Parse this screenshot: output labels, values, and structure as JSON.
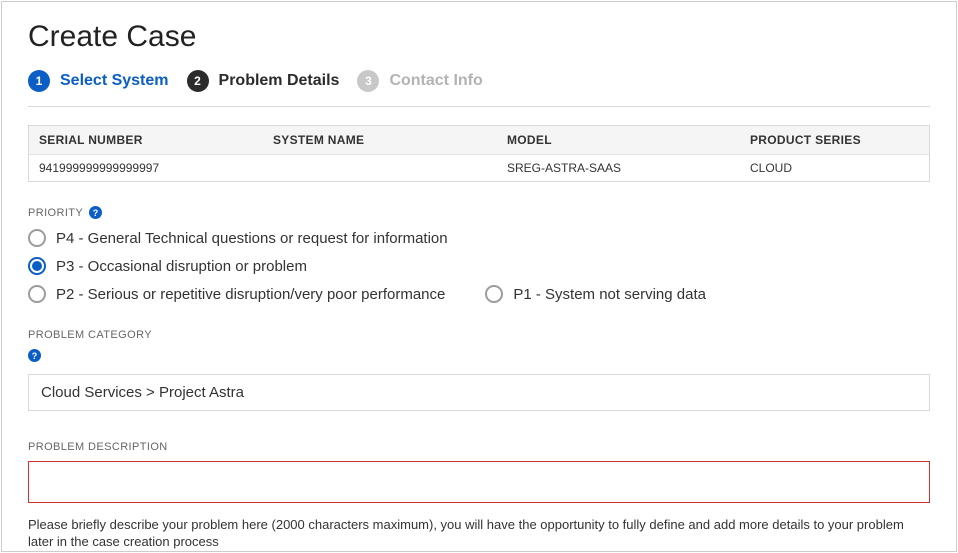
{
  "title": "Create Case",
  "steps": [
    {
      "num": "1",
      "label": "Select System",
      "state": "active"
    },
    {
      "num": "2",
      "label": "Problem Details",
      "state": "dark"
    },
    {
      "num": "3",
      "label": "Contact Info",
      "state": "muted"
    }
  ],
  "table": {
    "headers": {
      "serial": "SERIAL NUMBER",
      "name": "SYSTEM NAME",
      "model": "MODEL",
      "series": "PRODUCT SERIES"
    },
    "row": {
      "serial": "941999999999999997",
      "name": "",
      "model": "SREG-ASTRA-SAAS",
      "series": "CLOUD"
    }
  },
  "priority": {
    "label": "PRIORITY",
    "options": {
      "p4": "P4 - General Technical questions or request for information",
      "p3": "P3 - Occasional disruption or problem",
      "p2": "P2 - Serious or repetitive disruption/very poor performance",
      "p1": "P1 - System not serving data"
    },
    "selected": "p3"
  },
  "category": {
    "label": "PROBLEM CATEGORY",
    "value": "Cloud Services > Project Astra"
  },
  "description": {
    "label": "PROBLEM DESCRIPTION",
    "value": "",
    "hint": "Please briefly describe your problem here (2000 characters maximum), you will have the opportunity to fully define and add more details to your problem later in the case creation process"
  }
}
